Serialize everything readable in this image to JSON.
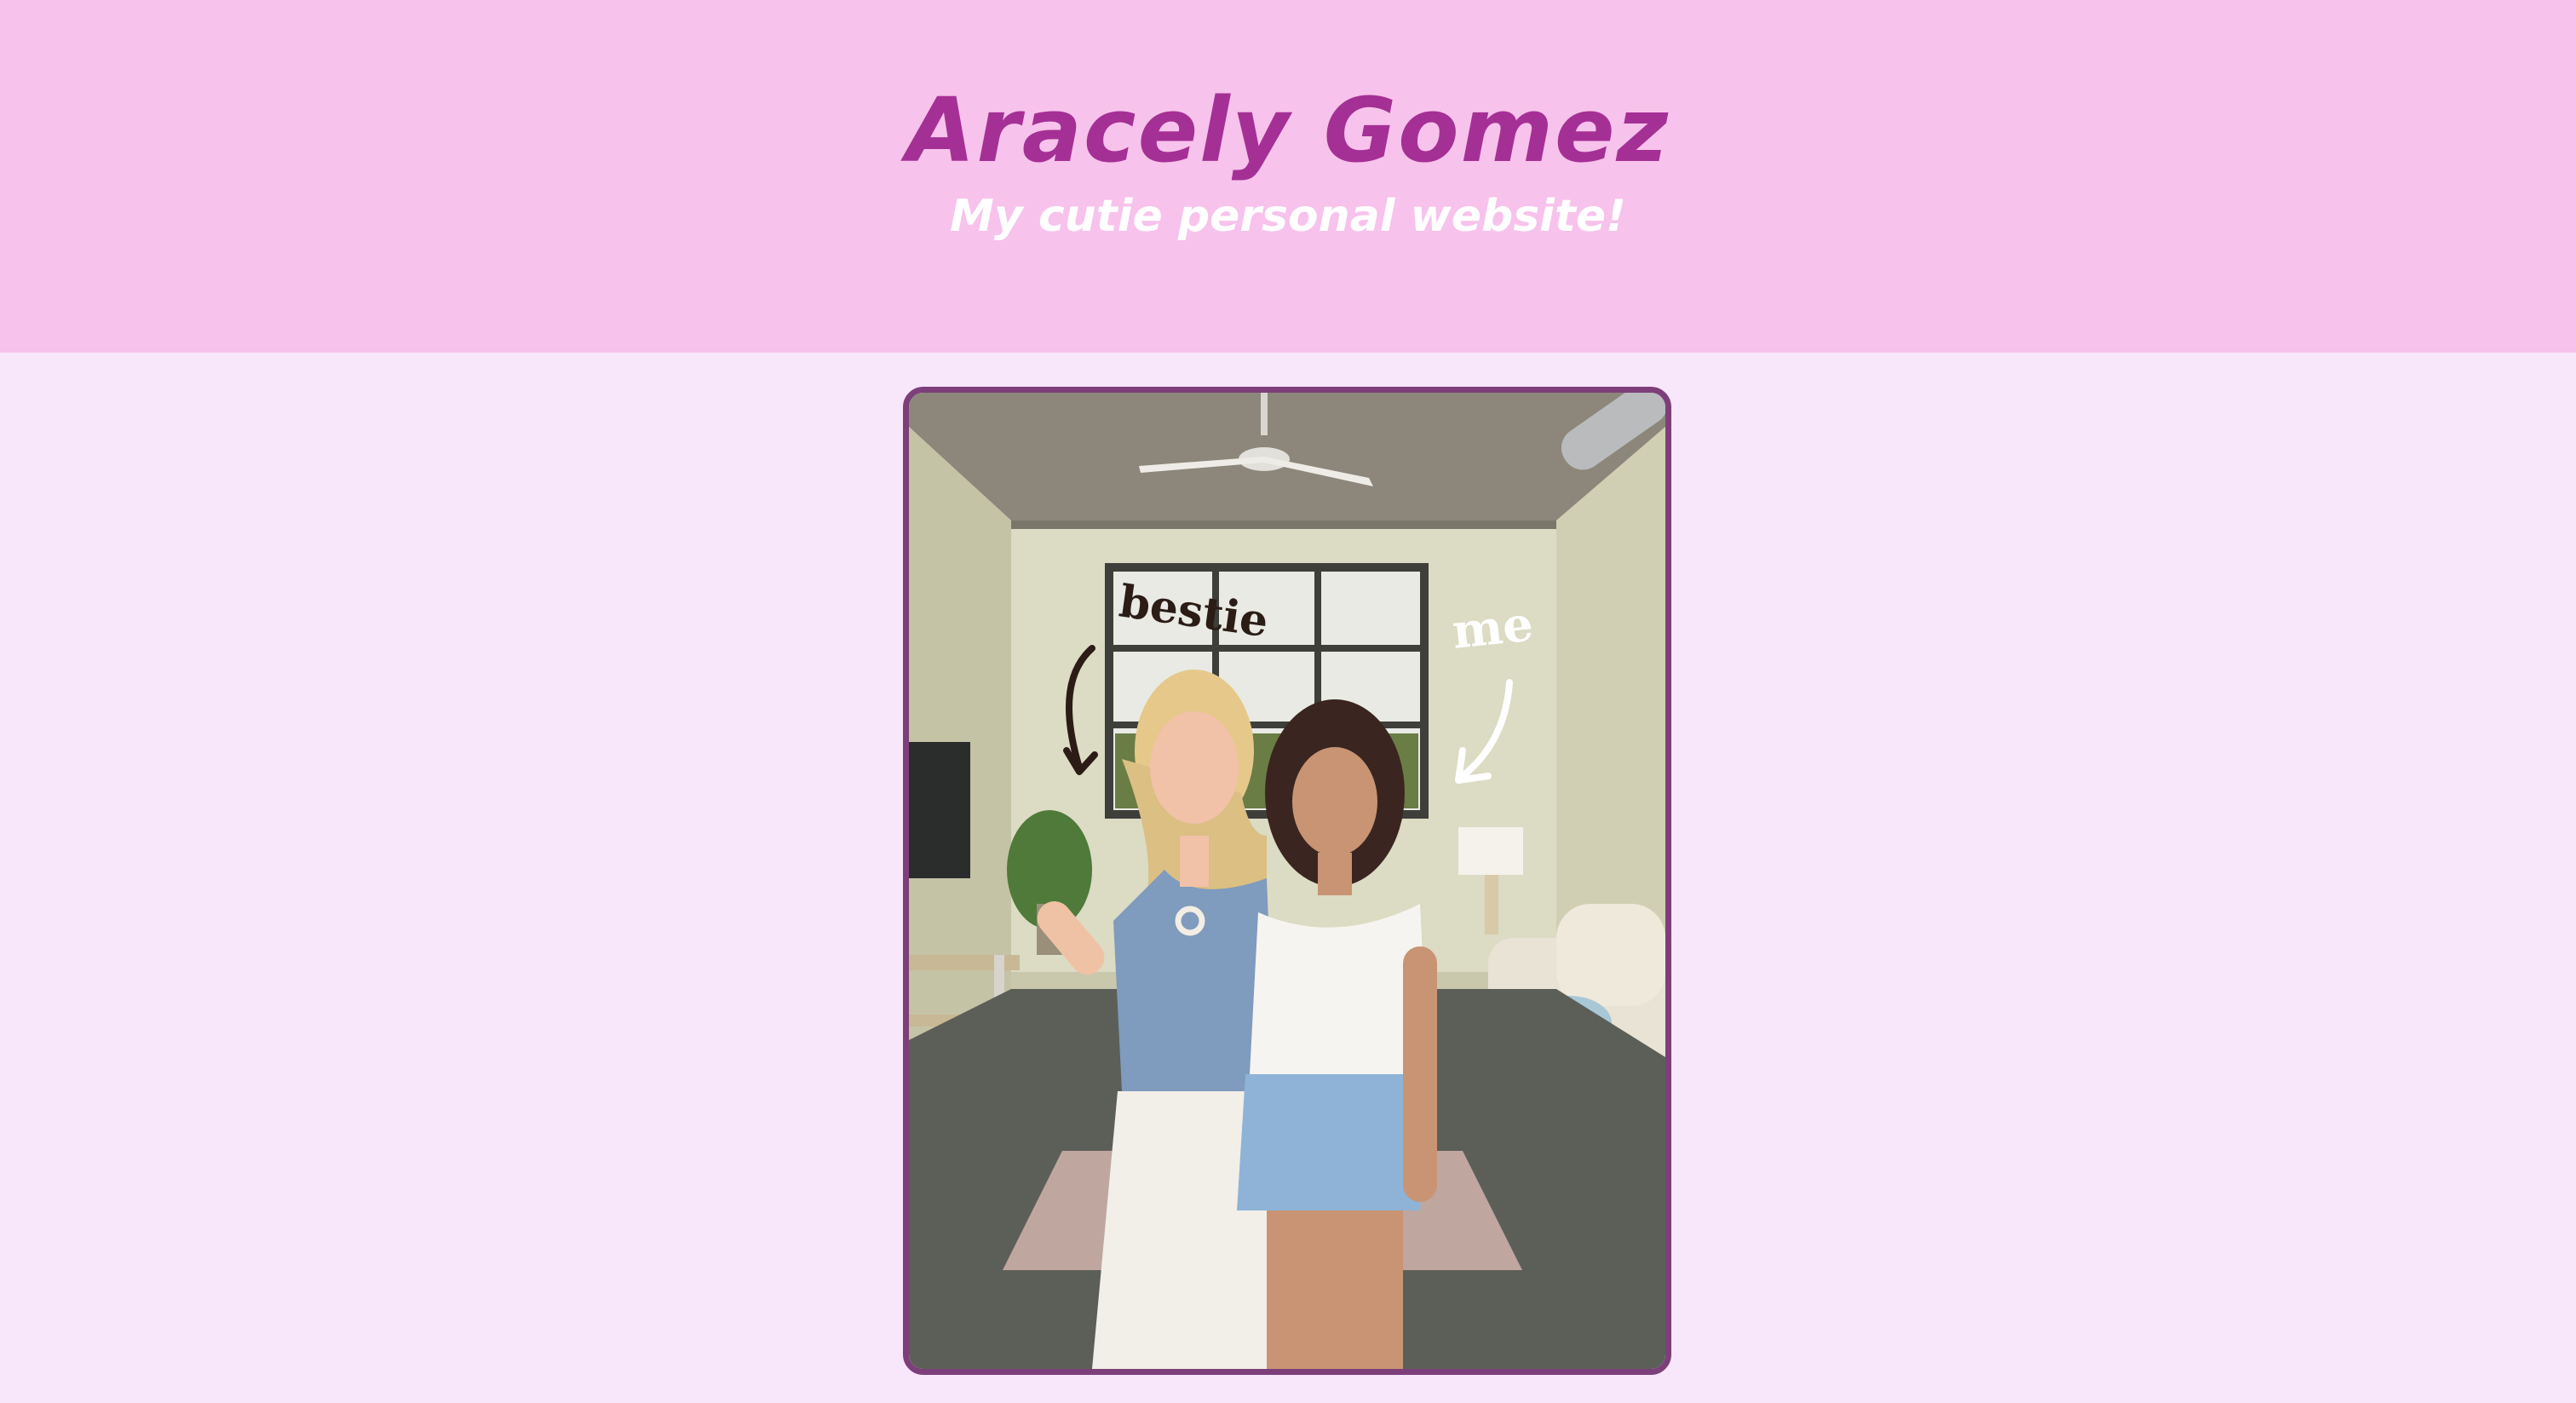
{
  "header": {
    "title": "Aracely Gomez",
    "subtitle": "My cutie personal website!"
  },
  "photo": {
    "annotations": {
      "left_label": "bestie",
      "right_label": "me"
    }
  },
  "colors": {
    "header_bg": "#f7c2eb",
    "page_bg": "#f8e6fb",
    "title_color": "#a53095",
    "frame_border": "#7d3f7a"
  }
}
